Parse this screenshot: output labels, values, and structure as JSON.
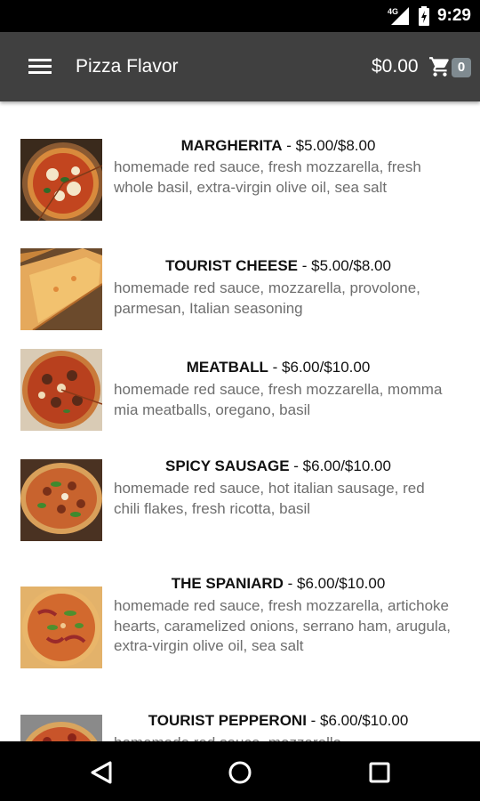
{
  "status_bar": {
    "time": "9:29",
    "network_label": "4G"
  },
  "app_bar": {
    "title": "Pizza Flavor",
    "cart_total": "$0.00",
    "cart_count": "0"
  },
  "menu": {
    "items": [
      {
        "name": "MARGHERITA",
        "separator": " - ",
        "price": "$5.00/$8.00",
        "description": "homemade red sauce, fresh mozzarella, fresh whole basil, extra-virgin olive oil, sea salt"
      },
      {
        "name": "TOURIST CHEESE",
        "separator": " - ",
        "price": "$5.00/$8.00",
        "description": "homemade red sauce, mozzarella, provolone, parmesan, Italian seasoning"
      },
      {
        "name": "MEATBALL",
        "separator": " - ",
        "price": "$6.00/$10.00",
        "description": "homemade red sauce, fresh mozzarella, momma mia meatballs, oregano, basil"
      },
      {
        "name": "SPICY SAUSAGE",
        "separator": " - ",
        "price": "$6.00/$10.00",
        "description": "homemade red sauce, hot italian sausage, red chili flakes, fresh ricotta, basil"
      },
      {
        "name": "THE SPANIARD",
        "separator": " - ",
        "price": "$6.00/$10.00",
        "description": "homemade red sauce, fresh mozzarella, artichoke hearts, caramelized onions, serrano ham, arugula, extra-virgin olive oil, sea salt"
      },
      {
        "name": "TOURIST PEPPERONI",
        "separator": " - ",
        "price": "$6.00/$10.00",
        "description": "homemade red sauce, mozzarella"
      }
    ]
  },
  "colors": {
    "app_bar": "#404040",
    "status_bar": "#000000",
    "badge": "#7f8a90",
    "description_text": "#6e6e6e"
  },
  "icons": {
    "menu": "hamburger-icon",
    "cart": "cart-icon",
    "back": "back-triangle-icon",
    "home": "home-circle-icon",
    "recents": "recents-square-icon"
  }
}
